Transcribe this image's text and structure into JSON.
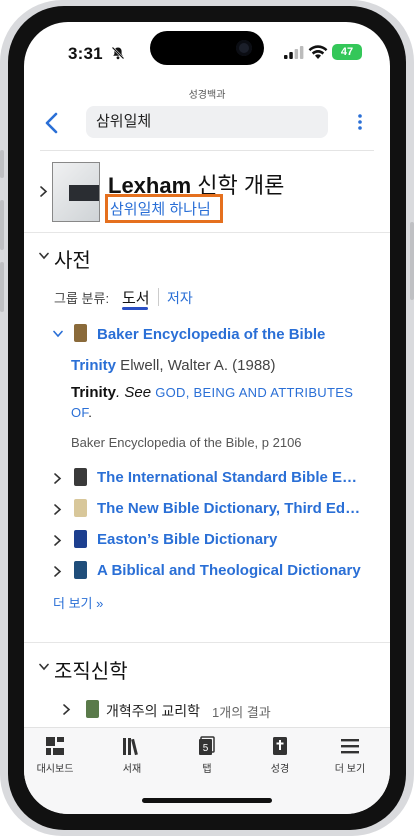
{
  "status_bar": {
    "time": "3:31",
    "battery": "47"
  },
  "app": {
    "title": "성경백과"
  },
  "search": {
    "value": "삼위일체"
  },
  "resource": {
    "title_bold": "Lexham",
    "title_rest": " 신학 개론",
    "link": "삼위일체 하나님"
  },
  "dictionary": {
    "heading": "사전",
    "group_label": "그룹 분류:",
    "tab_books": "도서",
    "tab_author": "저자",
    "first_book": "Baker Encyclopedia of the Bible",
    "article": {
      "title": "Trinity",
      "author_year": " Elwell, Walter A. (1988)",
      "bold": "Trinity",
      "see_text": ". See ",
      "see_link": "God, Being and Attributes",
      "see_link_cont": "of",
      "period": ".",
      "source": "Baker Encyclopedia of the Bible, p 2106"
    },
    "books": [
      "The International Standard Bible E…",
      "The New Bible Dictionary, Third Ed…",
      "Easton’s Bible Dictionary",
      "A Biblical and Theological Dictionary"
    ],
    "more": "더 보기 »"
  },
  "systematic": {
    "heading": "조직신학",
    "item_title": "개혁주의 교리학",
    "item_count": "1개의 결과"
  },
  "tabbar": {
    "dashboard": "대시보드",
    "library": "서재",
    "tabs": "탭",
    "tabs_count": "5",
    "bible": "성경",
    "more": "더 보기"
  },
  "colors": {
    "link": "#2a6fd6",
    "highlight": "#e5701e",
    "battery": "#34c759"
  }
}
